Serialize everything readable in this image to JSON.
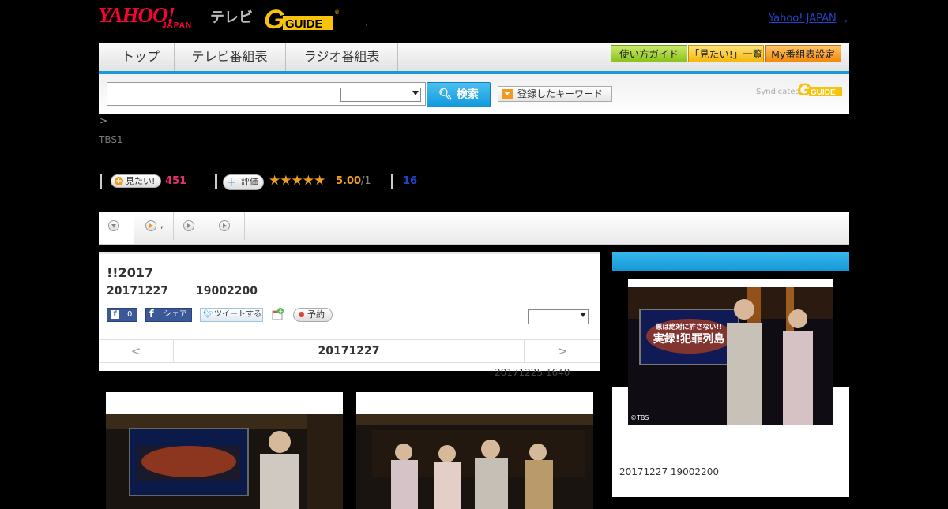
{
  "header": {
    "logo_yahoo": "YAHOO!",
    "logo_japan": "JAPAN",
    "logo_tv": "テレビ",
    "logo_gguide": "G-GUIDE",
    "dot": ",",
    "yahoo_japan_link": "Yahoo! JAPAN",
    "right_dot": ","
  },
  "nav": {
    "tabs": [
      {
        "label": "トップ"
      },
      {
        "label": "テレビ番組表"
      },
      {
        "label": "ラジオ番組表"
      }
    ],
    "guide_btn": "使い方ガイド",
    "mitai_list_btn": "「見たい!」一覧",
    "my_settings_btn": "My番組表設定"
  },
  "search": {
    "input_value": "",
    "select_value": "",
    "button_label": "検索",
    "keyword_button": "登録したキーワード",
    "syndicated": "Syndicated"
  },
  "breadcrumb": ">",
  "channel": "TBS1",
  "rating": {
    "mitai_label": "見たい!",
    "mitai_count": "451",
    "hyoka_label": "評価",
    "stars": "★★★★★",
    "score": "5.00",
    "score_den": "/1",
    "review_count": "16"
  },
  "tabs": [
    {
      "label": ""
    },
    {
      "label": ","
    },
    {
      "label": ""
    },
    {
      "label": ""
    }
  ],
  "program": {
    "title": "!!2017",
    "date": "20171227",
    "time": "19002200",
    "fb_like_count": "0",
    "fb_share": "シェア",
    "tweet": "ツイートする",
    "yoyaku": "予約",
    "nav_prev": "<",
    "nav_date": "20171227",
    "nav_next": ">",
    "update_note": "20171225  1640"
  },
  "right": {
    "date": "20171227  19002200",
    "copyright": "©TBS",
    "photo_title_line1": "悪は絶対に許さない!!",
    "photo_title_line2": "実録!犯罪列島"
  }
}
